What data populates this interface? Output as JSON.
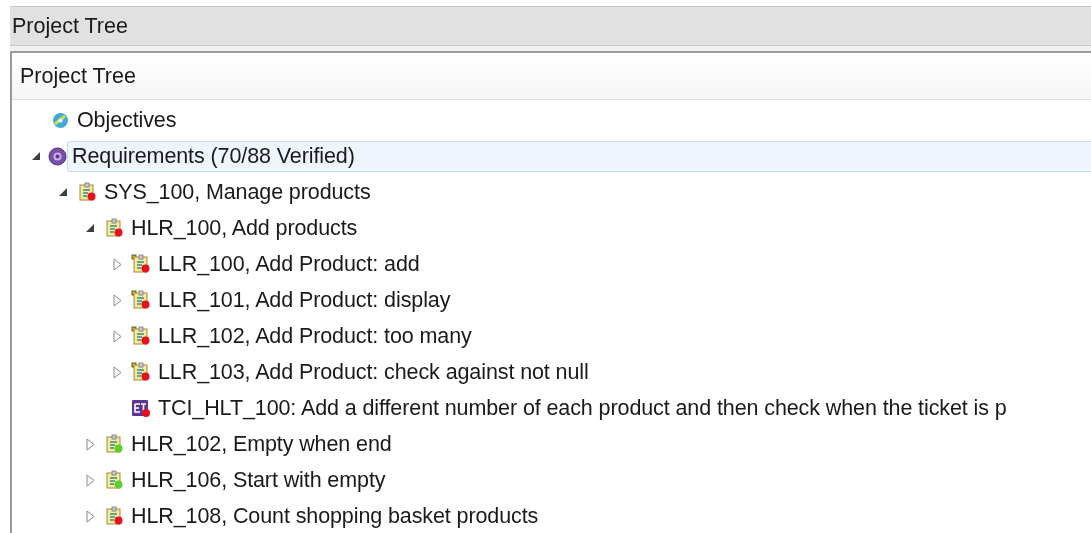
{
  "window": {
    "title": "Project Tree"
  },
  "panel": {
    "header": "Project Tree"
  },
  "tree": [
    {
      "kind": "objectives",
      "label": "Objectives",
      "selected": false
    },
    {
      "kind": "root",
      "label": "Requirements (70/88 Verified)",
      "selected": true,
      "expanded": true,
      "children": [
        {
          "kind": "requirement",
          "label": "SYS_100, Manage products",
          "selected": false,
          "expanded": true,
          "color": "#e8101a",
          "children": [
            {
              "kind": "requirement",
              "label": "HLR_100, Add products",
              "selected": false,
              "expanded": true,
              "color": "#e8101a",
              "children": [
                {
                  "kind": "low-requirement",
                  "label": "LLR_100, Add Product: add",
                  "selected": false,
                  "expanded": false,
                  "color": "#e8101a"
                },
                {
                  "kind": "low-requirement",
                  "label": "LLR_101, Add Product: display",
                  "selected": false,
                  "expanded": false,
                  "color": "#e8101a"
                },
                {
                  "kind": "low-requirement",
                  "label": "LLR_102, Add Product: too many",
                  "selected": false,
                  "expanded": false,
                  "color": "#e8101a"
                },
                {
                  "kind": "low-requirement",
                  "label": "LLR_103, Add Product: check against not null",
                  "selected": false,
                  "expanded": false,
                  "color": "#e8101a"
                },
                {
                  "kind": "test",
                  "label": "TCI_HLT_100: Add a different number of each product and then check when the ticket is p",
                  "selected": false,
                  "color": "#e8101a"
                }
              ]
            },
            {
              "kind": "requirement",
              "label": "HLR_102, Empty when end",
              "selected": false,
              "expanded": false,
              "color": "#5ccf2a"
            },
            {
              "kind": "requirement",
              "label": "HLR_106, Start with empty",
              "selected": false,
              "expanded": false,
              "color": "#5ccf2a"
            },
            {
              "kind": "requirement",
              "label": "HLR_108, Count shopping basket products",
              "selected": false,
              "expanded": false,
              "color": "#e8101a"
            }
          ]
        }
      ]
    }
  ]
}
